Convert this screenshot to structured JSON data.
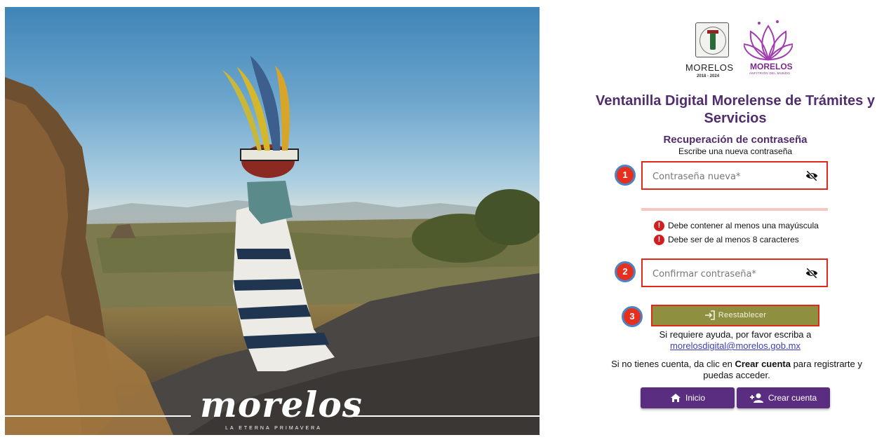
{
  "hero": {
    "logo_text": "morelos",
    "tagline": "LA ETERNA PRIMAVERA"
  },
  "header": {
    "state_name": "MORELOS",
    "state_years": "2018 - 2024",
    "brand_name": "MORELOS",
    "brand_sub": "ANFITRIÓN DEL MUNDO"
  },
  "title": "Ventanilla Digital Morelense de Trámites y Servicios",
  "subtitle": "Recuperación de contraseña",
  "instruction": "Escribe una nueva contraseña",
  "fields": {
    "new_password": {
      "placeholder": "Contraseña nueva*",
      "value": ""
    },
    "confirm_password": {
      "placeholder": "Confirmar contraseña*",
      "value": ""
    }
  },
  "badges": [
    "1",
    "2",
    "3"
  ],
  "rules": [
    "Debe contener al menos una mayúscula",
    "Debe ser de al menos 8 caracteres"
  ],
  "reset_button": "Reestablecer",
  "help": {
    "text": "Si requiere ayuda, por favor escriba a",
    "email": "morelosdigital@morelos.gob.mx"
  },
  "signup": {
    "before": "Si no tienes cuenta, da clic en ",
    "bold": "Crear cuenta",
    "after": " para registrarte y puedas acceder."
  },
  "nav": {
    "home": "Inicio",
    "create": "Crear cuenta"
  },
  "colors": {
    "primary": "#512c6e",
    "button": "#5a2d81",
    "reset": "#8e8f3f",
    "highlight": "#e2271b",
    "error": "#d01f1f"
  }
}
